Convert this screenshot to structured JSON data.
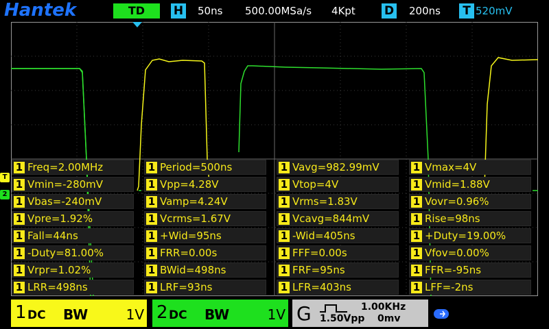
{
  "header": {
    "brand": "Hantek",
    "mode": "TD",
    "horizontal_icon": "H",
    "timebase": "50ns",
    "sample_rate": "500.00MSa/s",
    "memory_depth": "4Kpt",
    "delay_icon": "D",
    "delay": "200ns",
    "trigger_icon": "T",
    "trigger_level": "520mV"
  },
  "markers": {
    "trigger_marker": "T",
    "ch2_marker": "2"
  },
  "measurements": [
    {
      "ch": "1",
      "text": "Freq=2.00MHz"
    },
    {
      "ch": "1",
      "text": "Period=500ns"
    },
    {
      "ch": "1",
      "text": "Vavg=982.99mV"
    },
    {
      "ch": "1",
      "text": "Vmax=4V"
    },
    {
      "ch": "1",
      "text": "Vmin=-280mV"
    },
    {
      "ch": "1",
      "text": "Vpp=4.28V"
    },
    {
      "ch": "1",
      "text": "Vtop=4V"
    },
    {
      "ch": "1",
      "text": "Vmid=1.88V"
    },
    {
      "ch": "1",
      "text": "Vbas=-240mV"
    },
    {
      "ch": "1",
      "text": "Vamp=4.24V"
    },
    {
      "ch": "1",
      "text": "Vrms=1.83V"
    },
    {
      "ch": "1",
      "text": "Vovr=0.96%"
    },
    {
      "ch": "1",
      "text": "Vpre=1.92%"
    },
    {
      "ch": "1",
      "text": "Vcrms=1.67V"
    },
    {
      "ch": "1",
      "text": "Vcavg=844mV"
    },
    {
      "ch": "1",
      "text": "Rise=98ns"
    },
    {
      "ch": "1",
      "text": "Fall=44ns"
    },
    {
      "ch": "1",
      "text": "+Wid=95ns"
    },
    {
      "ch": "1",
      "text": "-Wid=405ns"
    },
    {
      "ch": "1",
      "text": "+Duty=19.00%"
    },
    {
      "ch": "1",
      "text": "-Duty=81.00%"
    },
    {
      "ch": "1",
      "text": "FRR=0.00s"
    },
    {
      "ch": "1",
      "text": "FFF=0.00s"
    },
    {
      "ch": "1",
      "text": "Vfov=0.00%"
    },
    {
      "ch": "1",
      "text": "Vrpr=1.02%"
    },
    {
      "ch": "1",
      "text": "BWid=498ns"
    },
    {
      "ch": "1",
      "text": "FRF=95ns"
    },
    {
      "ch": "1",
      "text": "FFR=-95ns"
    },
    {
      "ch": "1",
      "text": "LRR=498ns"
    },
    {
      "ch": "1",
      "text": "LRF=93ns"
    },
    {
      "ch": "1",
      "text": "LFR=403ns"
    },
    {
      "ch": "1",
      "text": "LFF=-2ns"
    }
  ],
  "channel1": {
    "num": "1",
    "coupling": "DC",
    "bw": "BW",
    "scale": "1V",
    "color": "#f8f81a"
  },
  "channel2": {
    "num": "2",
    "coupling": "DC",
    "bw": "BW",
    "scale": "1V",
    "color": "#1ee01e"
  },
  "generator": {
    "label": "G",
    "frequency": "1.00KHz",
    "amplitude": "1.50Vpp",
    "offset": "0mv"
  },
  "status": {
    "usb_icon": "usb-icon"
  }
}
